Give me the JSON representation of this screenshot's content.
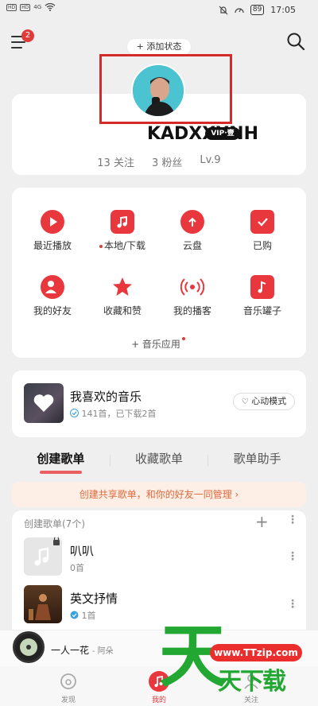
{
  "status_bar": {
    "time": "17:05",
    "battery": "89",
    "signal_labels": [
      "HD",
      "HD"
    ],
    "network": "4G"
  },
  "top_nav": {
    "badge_count": "2",
    "add_status_label": "+ 添加状态"
  },
  "profile": {
    "username": "KADXXXNH",
    "vip_label": "VIP·壹",
    "follow_label": "13 关注",
    "fans_label": "3 粉丝",
    "level_label": "Lv.9"
  },
  "functions": [
    {
      "label": "最近播放",
      "icon": "play-circle-icon"
    },
    {
      "label": "本地/下载",
      "icon": "local-music-icon",
      "dot": true
    },
    {
      "label": "云盘",
      "icon": "cloud-upload-icon"
    },
    {
      "label": "已购",
      "icon": "shopping-bag-icon"
    },
    {
      "label": "我的好友",
      "icon": "friends-icon"
    },
    {
      "label": "收藏和赞",
      "icon": "star-icon"
    },
    {
      "label": "我的播客",
      "icon": "broadcast-icon"
    },
    {
      "label": "音乐罐子",
      "icon": "music-jar-icon"
    }
  ],
  "music_app_label": "+ 音乐应用",
  "liked_music": {
    "title": "我喜欢的音乐",
    "subtitle": "141首，已下载2首",
    "heart_mode_label": "心动模式"
  },
  "tabs": [
    "创建歌单",
    "收藏歌单",
    "歌单助手"
  ],
  "banner_text": "创建共享歌单，和你的好友一同管理 ›",
  "playlists": {
    "header": "创建歌单(7个)",
    "items": [
      {
        "name": "叭叭",
        "count": "0首"
      },
      {
        "name": "英文抒情",
        "count": "1首"
      }
    ]
  },
  "mini_player": {
    "song": "一人一花",
    "artist": "- 阿朵"
  },
  "bottom_nav": [
    "发现",
    "我的",
    "关注"
  ],
  "watermark": {
    "char": "天",
    "url": "www.TTzip.com",
    "text": "天下载"
  },
  "colors": {
    "accent": "#e8383d",
    "background": "#efefef"
  }
}
